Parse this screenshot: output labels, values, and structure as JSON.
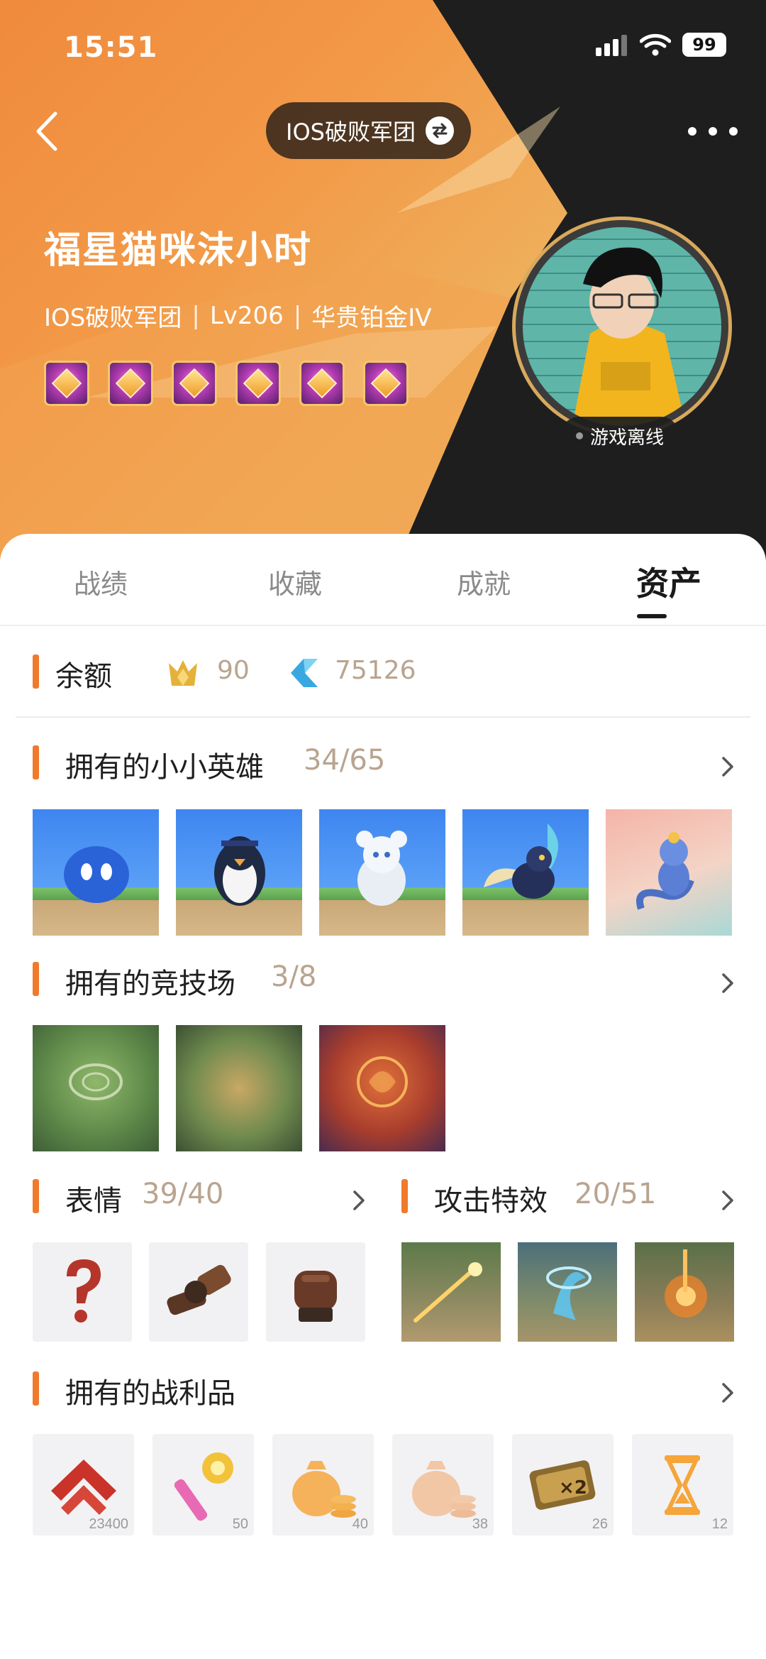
{
  "status_bar": {
    "time": "15:51",
    "battery": "99"
  },
  "nav": {
    "server_name": "IOS破败军团"
  },
  "profile": {
    "nickname": "福星猫咪沫小时",
    "server": "IOS破败军团",
    "level": "Lv206",
    "rank": "华贵铂金IV",
    "status": "游戏离线",
    "badge_count": 6
  },
  "tabs": [
    {
      "label": "战绩",
      "active": false
    },
    {
      "label": "收藏",
      "active": false
    },
    {
      "label": "成就",
      "active": false
    },
    {
      "label": "资产",
      "active": true
    }
  ],
  "balance": {
    "title": "余额",
    "coin_value": "90",
    "gem_value": "75126"
  },
  "legends": {
    "title": "拥有的小小英雄",
    "count": "34/65",
    "items": [
      "blue-spirit",
      "penguin",
      "white-cat",
      "moth-creature",
      "dragonet"
    ]
  },
  "arenas": {
    "title": "拥有的竞技场",
    "count": "3/8",
    "items": [
      "green-arena",
      "forest-arena",
      "fire-arena"
    ]
  },
  "emotes": {
    "title": "表情",
    "count": "39/40",
    "items": [
      "question-mark",
      "arm-flex",
      "fist"
    ]
  },
  "attack_fx": {
    "title": "攻击特效",
    "count": "20/51",
    "items": [
      "gold-strike",
      "blue-tornado",
      "orange-burst"
    ]
  },
  "loot": {
    "title": "拥有的战利品",
    "items": [
      {
        "icon": "rank-chevron-icon",
        "count": "23400"
      },
      {
        "icon": "golden-scepter-icon",
        "count": "50"
      },
      {
        "icon": "coin-bag-icon",
        "count": "40"
      },
      {
        "icon": "coin-bag-faded-icon",
        "count": "38"
      },
      {
        "icon": "double-ticket-icon",
        "count": "26"
      },
      {
        "icon": "hourglass-icon",
        "count": "12"
      }
    ]
  },
  "colors": {
    "accent": "#f07a2c",
    "count_text": "#b9a48f",
    "hero_orange": "#f08a3c",
    "hero_dark": "#1e1e1e"
  }
}
